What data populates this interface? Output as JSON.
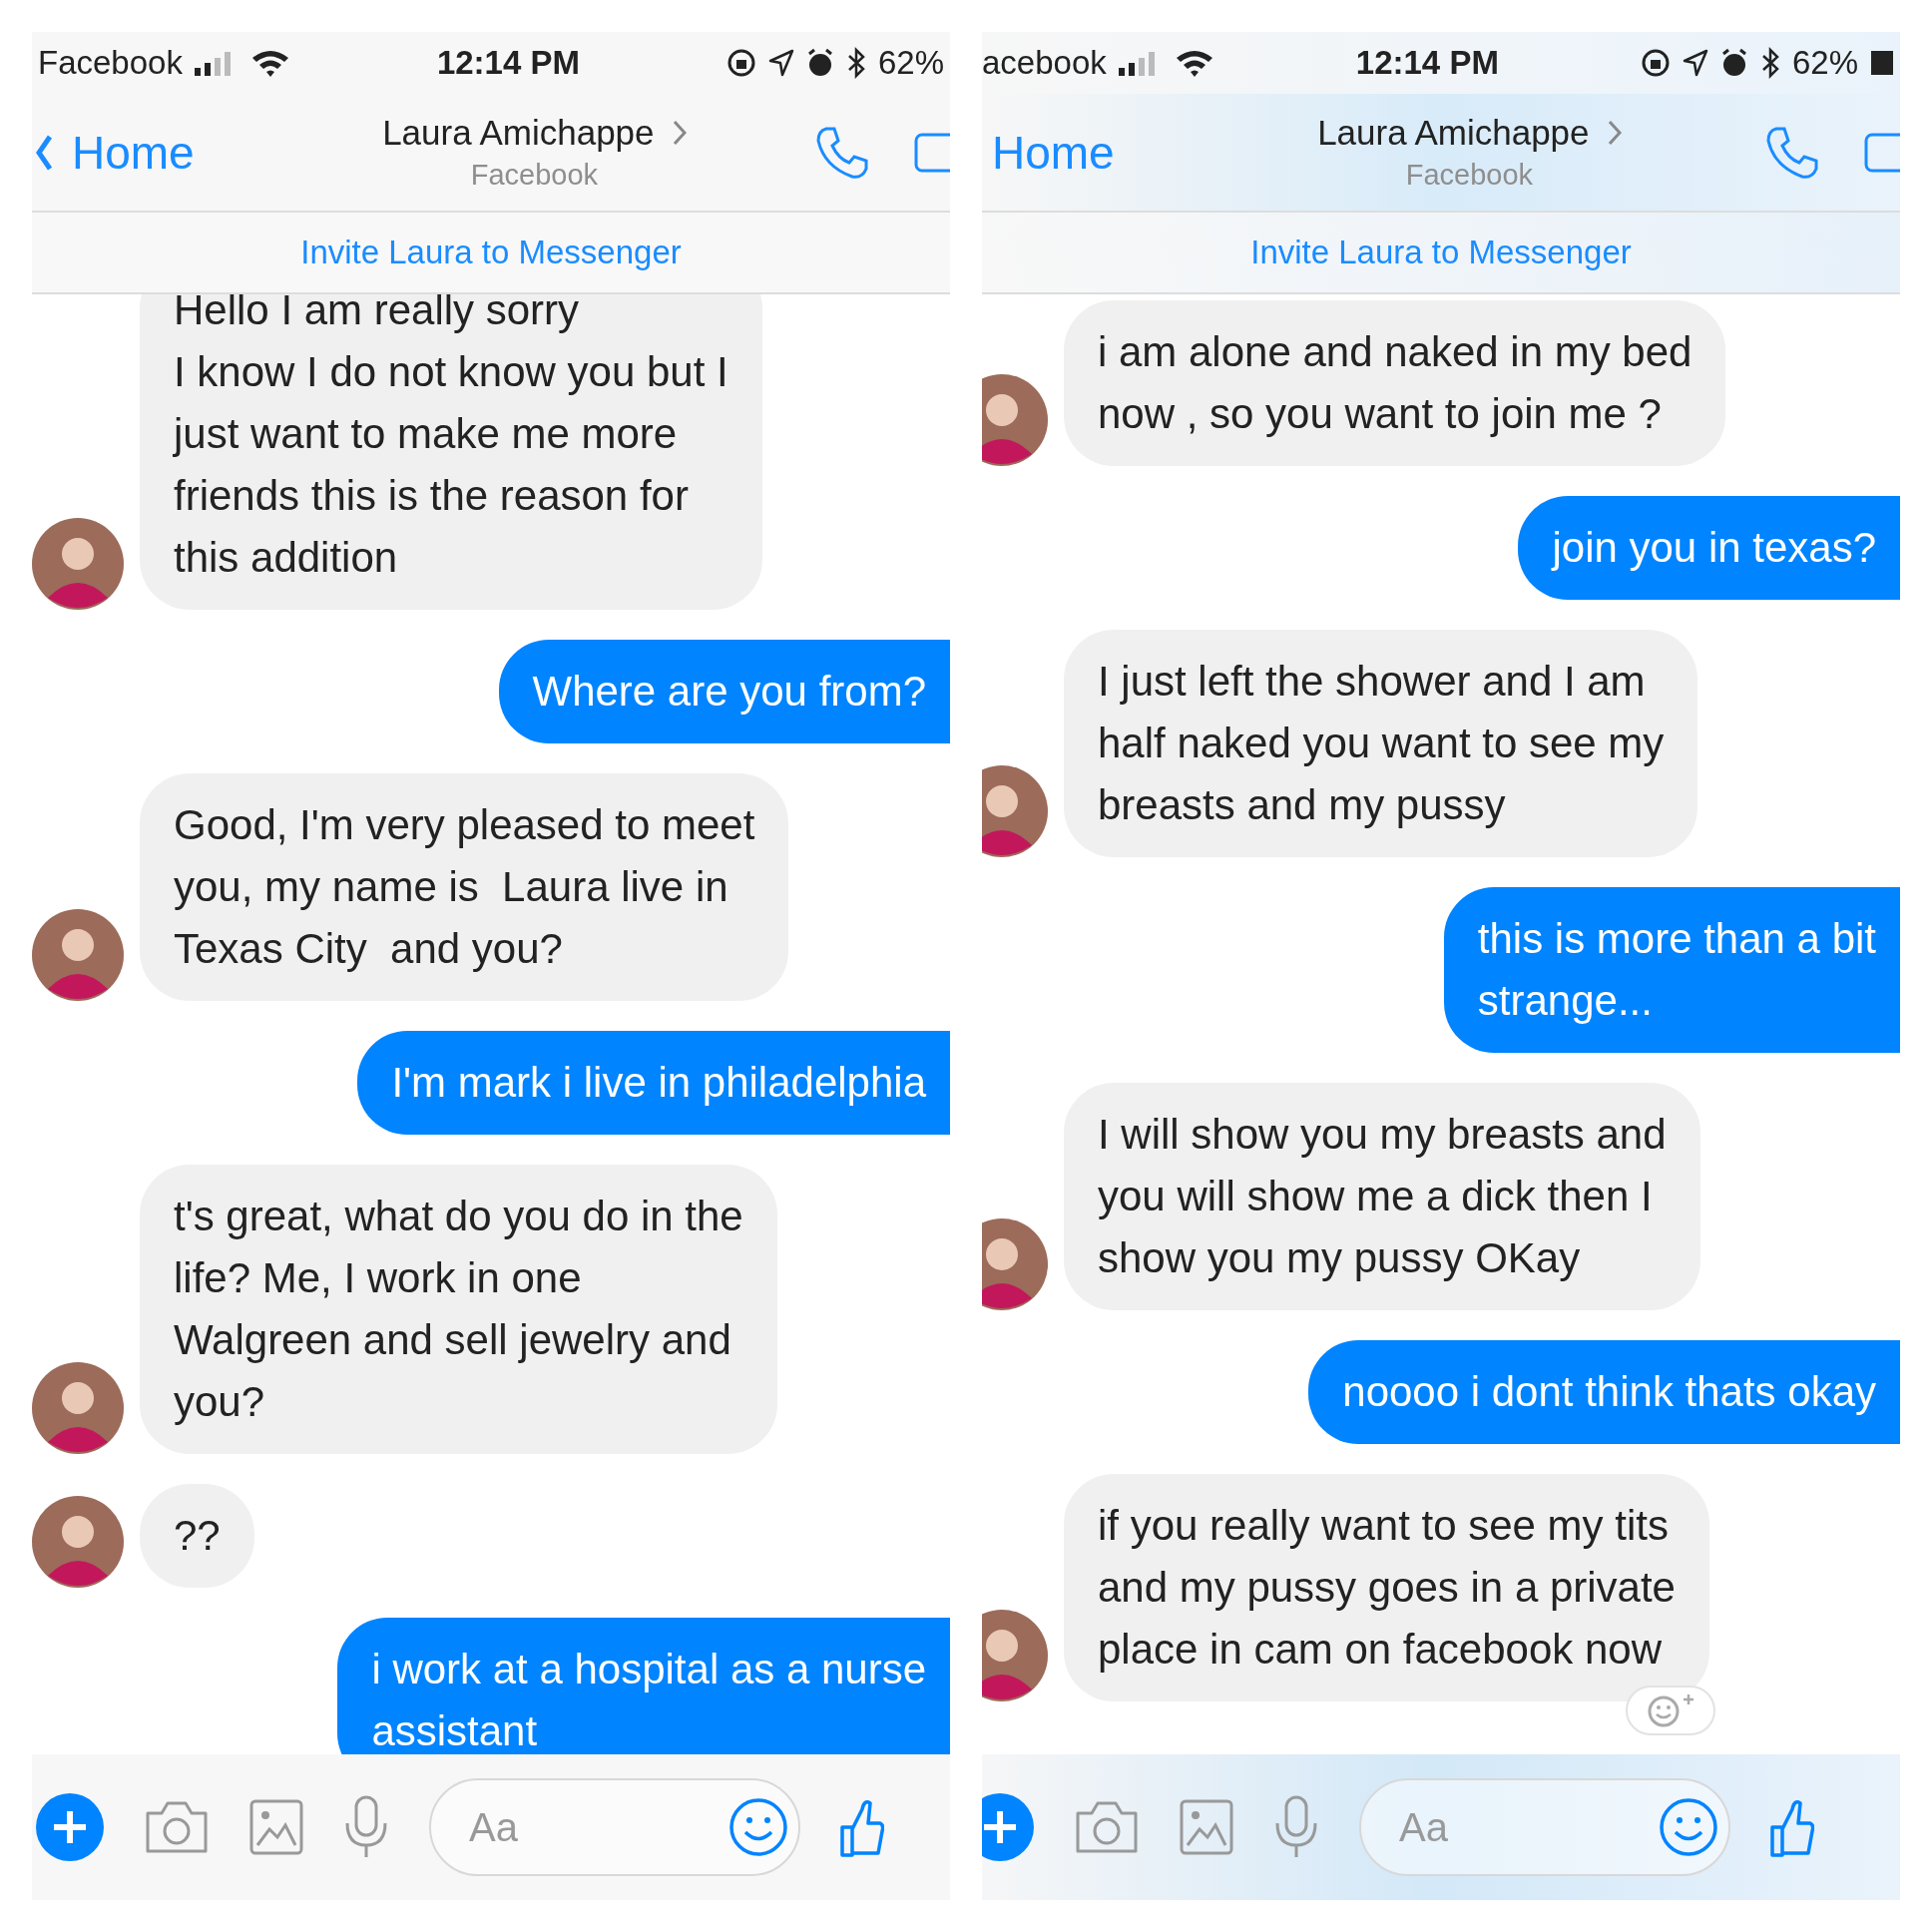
{
  "panels": [
    {
      "status_bar": {
        "carrier": "Facebook",
        "time": "12:14 PM",
        "battery": "62%",
        "battery_icon": false
      },
      "header": {
        "back": "Home",
        "back_chevron": true,
        "name": "Laura Amichappe",
        "subtitle": "Facebook"
      },
      "invite": "Invite Laura to Messenger",
      "messages": [
        {
          "kind": "received",
          "text": "Hello I am really sorry\nI know I do not know you but I\njust want to make me more\nfriends this is the reason for\nthis addition"
        },
        {
          "kind": "sent",
          "text": "Where are you from?"
        },
        {
          "kind": "received",
          "text": "Good, I'm very pleased to meet\nyou, my name is  Laura live in\nTexas City  and you?"
        },
        {
          "kind": "sent",
          "text": "I'm mark i live in philadelphia"
        },
        {
          "kind": "received",
          "text": "t's great, what do you do in the\nlife? Me, I work in one\nWalgreen and sell jewelry and\nyou?"
        },
        {
          "kind": "received",
          "text": "??"
        },
        {
          "kind": "sent",
          "text": "i work at a hospital as a nurse\nassistant"
        }
      ],
      "composer": {
        "placeholder": "Aa"
      }
    },
    {
      "status_bar": {
        "carrier": "acebook",
        "time": "12:14 PM",
        "battery": "62%",
        "battery_icon": true
      },
      "header": {
        "back": "Home",
        "back_chevron": false,
        "name": "Laura Amichappe",
        "subtitle": "Facebook"
      },
      "invite": "Invite Laura to Messenger",
      "messages": [
        {
          "kind": "received",
          "text": "i am alone and naked in my bed\nnow , so you want to join me ?"
        },
        {
          "kind": "sent",
          "text": "join you in texas?"
        },
        {
          "kind": "received",
          "text": "I just left the shower and I am\nhalf naked you want to see my\nbreasts and my pussy"
        },
        {
          "kind": "sent",
          "text": "this is more than a bit\nstrange..."
        },
        {
          "kind": "received",
          "text": "I will show you my breasts and\nyou will show me a dick then I\nshow you my pussy OKay"
        },
        {
          "kind": "sent",
          "text": "noooo i dont think thats okay"
        },
        {
          "kind": "received",
          "text": "if you really want to see my tits\nand my pussy goes in a private\nplace in cam on facebook now",
          "reaction_button": true
        }
      ],
      "composer": {
        "placeholder": "Aa"
      }
    }
  ]
}
